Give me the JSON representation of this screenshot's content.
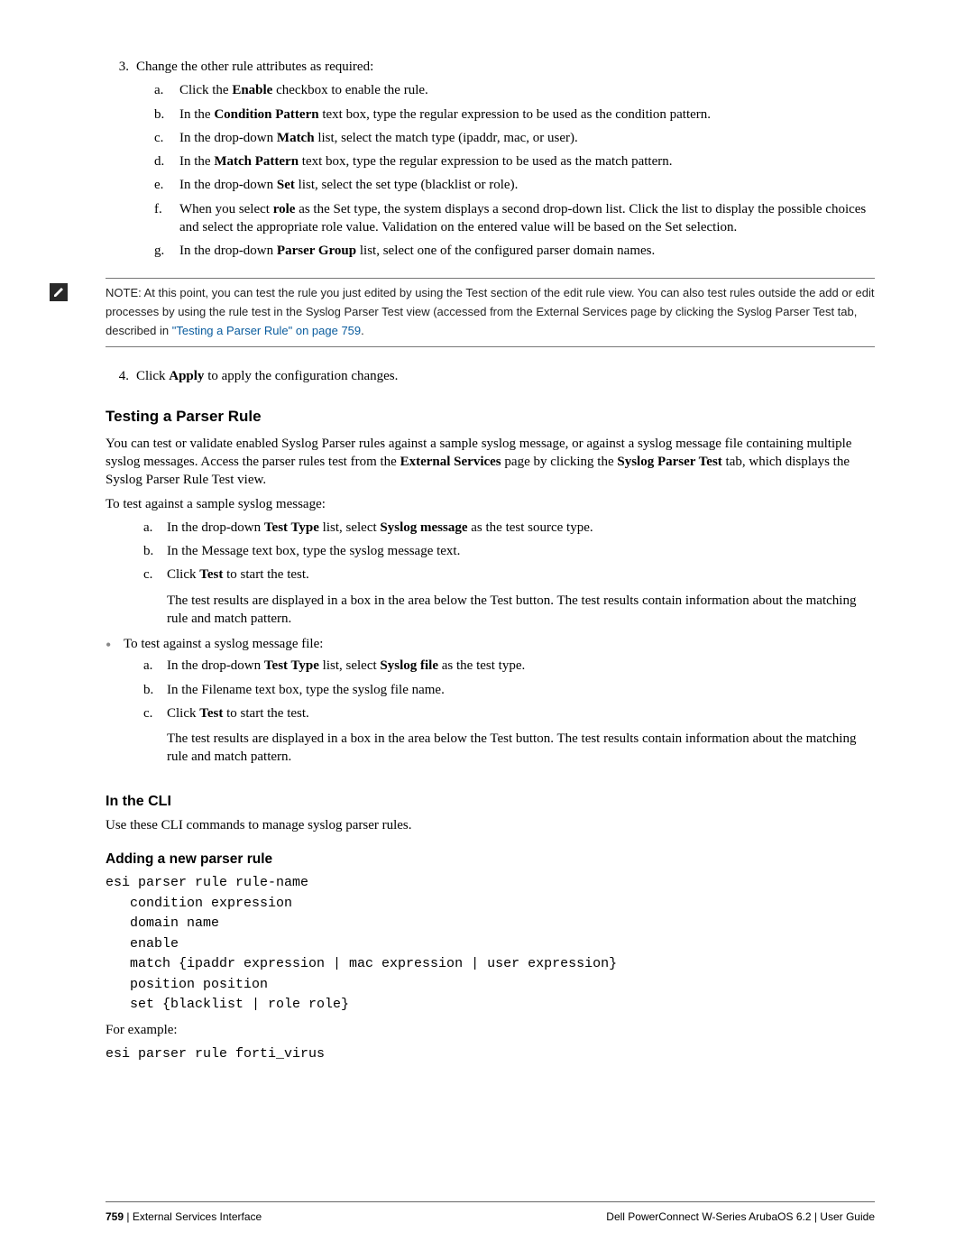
{
  "step3": {
    "marker": "3.",
    "text": "Change the other rule attributes as required:",
    "a": {
      "m": "a.",
      "pre": "Click the ",
      "bold": "Enable",
      "post": " checkbox to enable the rule."
    },
    "b": {
      "m": "b.",
      "pre": "In the ",
      "bold": "Condition Pattern",
      "post": " text box, type the regular expression to be used as the condition pattern."
    },
    "c": {
      "m": "c.",
      "pre": "In the drop-down ",
      "bold": "Match",
      "post": " list, select the match type (ipaddr, mac, or user)."
    },
    "d": {
      "m": "d.",
      "pre": "In the ",
      "bold": "Match Pattern",
      "post": " text box, type the regular expression to be used as the match pattern."
    },
    "e": {
      "m": "e.",
      "pre": "In the drop-down ",
      "bold": "Set",
      "post": " list, select the set type (blacklist or role)."
    },
    "f": {
      "m": "f.",
      "pre": "When you select ",
      "bold": "role",
      "post": " as the Set type, the system displays a second drop-down list. Click the list to display the possible choices and select the appropriate role value. Validation on the entered value will be based on the Set selection."
    },
    "g": {
      "m": "g.",
      "pre": "In the drop-down ",
      "bold": "Parser Group",
      "post": " list, select one of the configured parser domain names."
    }
  },
  "note": {
    "text": "NOTE: At this point, you can test the rule you just edited by using the Test section of the edit rule view. You can also test rules outside the add or edit processes by using the rule test in the Syslog Parser Test view (accessed from the External Services page by clicking the Syslog Parser Test tab, described in ",
    "link": "\"Testing a Parser Rule\" on page 759",
    "period": "."
  },
  "step4": {
    "marker": "4.",
    "pre": "Click ",
    "bold": "Apply",
    "post": " to apply the configuration changes."
  },
  "h2": "Testing a Parser Rule",
  "testing_para_1": "You can test or validate enabled Syslog Parser rules against a sample syslog message, or against a syslog message file containing multiple syslog messages. Access the parser rules test from the ",
  "testing_para_1_bold1": "External Services",
  "testing_para_1_mid": " page by clicking the ",
  "testing_para_1_bold2": "Syslog Parser Test",
  "testing_para_1_end": " tab, which displays the Syslog Parser Rule Test view.",
  "testing_para_2": "To test against a sample syslog message:",
  "msg": {
    "a": {
      "m": "a.",
      "pre": "In the drop-down ",
      "bold1": "Test Type",
      "mid": " list, select ",
      "bold2": "Syslog message",
      "post": " as the test source type."
    },
    "b": {
      "m": "b.",
      "text": "In the Message text box, type the syslog message text."
    },
    "c": {
      "m": "c.",
      "pre": "Click ",
      "bold": "Test",
      "post": " to start the test.",
      "extra": "The test results are displayed in a box in the area below the Test button. The test results contain information about the matching rule and match pattern."
    }
  },
  "bullet_file": "To test against a syslog message file:",
  "file": {
    "a": {
      "m": "a.",
      "pre": "In the drop-down ",
      "bold1": "Test Type",
      "mid": " list, select ",
      "bold2": "Syslog file",
      "post": " as the test type."
    },
    "b": {
      "m": "b.",
      "text": "In the Filename text box, type the syslog file name."
    },
    "c": {
      "m": "c.",
      "pre": "Click ",
      "bold": "Test",
      "post": " to start the test.",
      "extra": "The test results are displayed in a box in the area below the Test button. The test results contain information about the matching rule and match pattern."
    }
  },
  "h3": "In the CLI",
  "cli_para": "Use these CLI commands to manage syslog parser rules.",
  "h4": "Adding a new parser rule",
  "code1": "esi parser rule rule-name\n   condition expression\n   domain name\n   enable\n   match {ipaddr expression | mac expression | user expression}\n   position position\n   set {blacklist | role role}",
  "for_example": "For example:",
  "code2": "esi parser rule forti_virus",
  "footer": {
    "page": "759",
    "sep": " | ",
    "section": "External Services Interface",
    "right_pre": "Dell PowerConnect W-Series ArubaOS 6.2  ",
    "right_sep": "|",
    "right_post": "  User Guide"
  }
}
